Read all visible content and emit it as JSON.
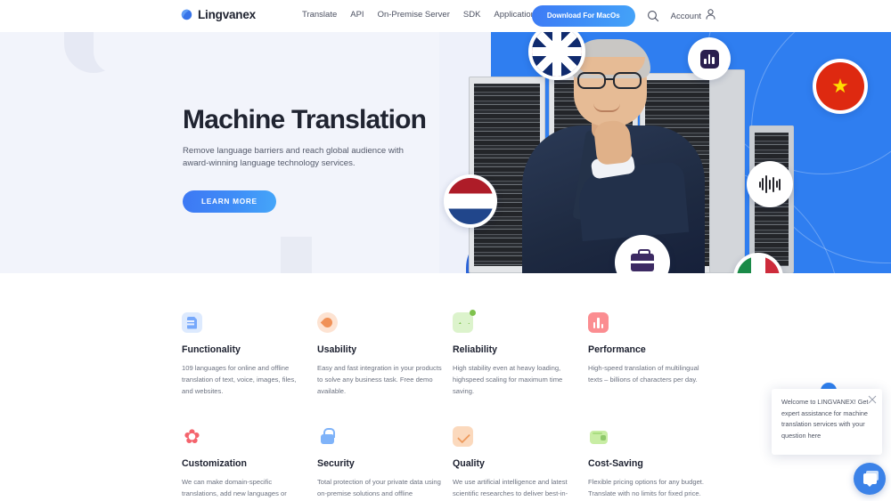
{
  "nav": {
    "logo_text": "Lingvanex",
    "logo_icon": "lingvanex-droplet-logo",
    "links": [
      {
        "label": "Translate",
        "icon": null
      },
      {
        "label": "API",
        "icon": null
      },
      {
        "label": "On-Premise Server",
        "icon": null
      },
      {
        "label": "SDK",
        "icon": null
      },
      {
        "label": "Applications",
        "icon": "chevron-down-icon"
      }
    ],
    "download_label": "Download For MacOs",
    "search_icon": "search-icon",
    "account_label": "Account",
    "account_icon": "user-icon"
  },
  "hero": {
    "title": "Machine Translation",
    "subtitle": "Remove language barriers and reach global audience with award-winning language technology services.",
    "cta_label": "LEARN MORE",
    "badges": [
      {
        "name": "uk-flag-badge",
        "kind": "flag",
        "country": "United Kingdom"
      },
      {
        "name": "netherlands-flag-badge",
        "kind": "flag",
        "country": "Netherlands"
      },
      {
        "name": "china-flag-badge",
        "kind": "flag",
        "country": "China",
        "glyph": "★"
      },
      {
        "name": "italy-flag-badge",
        "kind": "flag",
        "country": "Italy"
      },
      {
        "name": "bar-chart-badge",
        "kind": "icon"
      },
      {
        "name": "audio-wave-badge",
        "kind": "icon"
      },
      {
        "name": "briefcase-badge",
        "kind": "icon"
      }
    ]
  },
  "features": [
    {
      "icon": "document-icon",
      "title": "Functionality",
      "desc": "109 languages for online and offline translation of text, voice, images, files, and websites."
    },
    {
      "icon": "leaf-icon",
      "title": "Usability",
      "desc": "Easy and fast integration in your products to solve any business task. Free demo available."
    },
    {
      "icon": "chart-growth-icon",
      "title": "Reliability",
      "desc": "High stability even at heavy loading, highspeed scaling for maximum time saving."
    },
    {
      "icon": "bar-chart-icon",
      "title": "Performance",
      "desc": "High-speed translation of multilingual texts – billions of characters per day."
    },
    {
      "icon": "flower-gear-icon",
      "title": "Customization",
      "desc": "We can make domain-specific translations, add new languages or"
    },
    {
      "icon": "lock-icon",
      "title": "Security",
      "desc": "Total protection of your private data using on-premise solutions and offline"
    },
    {
      "icon": "checkmark-icon",
      "title": "Quality",
      "desc": "We use artificial intelligence and latest scientific researches to deliver best-in-"
    },
    {
      "icon": "wallet-icon",
      "title": "Cost-Saving",
      "desc": "Flexible pricing options for any budget. Translate with no limits for fixed price."
    }
  ],
  "chat": {
    "message": "Welcome to LINGVANEX! Get expert assistance for machine translation services with your question here",
    "close_icon": "close-icon",
    "fab_icon": "chat-bubble-icon"
  },
  "colors": {
    "brand_blue": "#3b82e8",
    "hero_bg": "#f2f4fb",
    "photo_blue": "#2f7ef0",
    "text_dark": "#1d2130",
    "text_muted": "#6c7280"
  }
}
